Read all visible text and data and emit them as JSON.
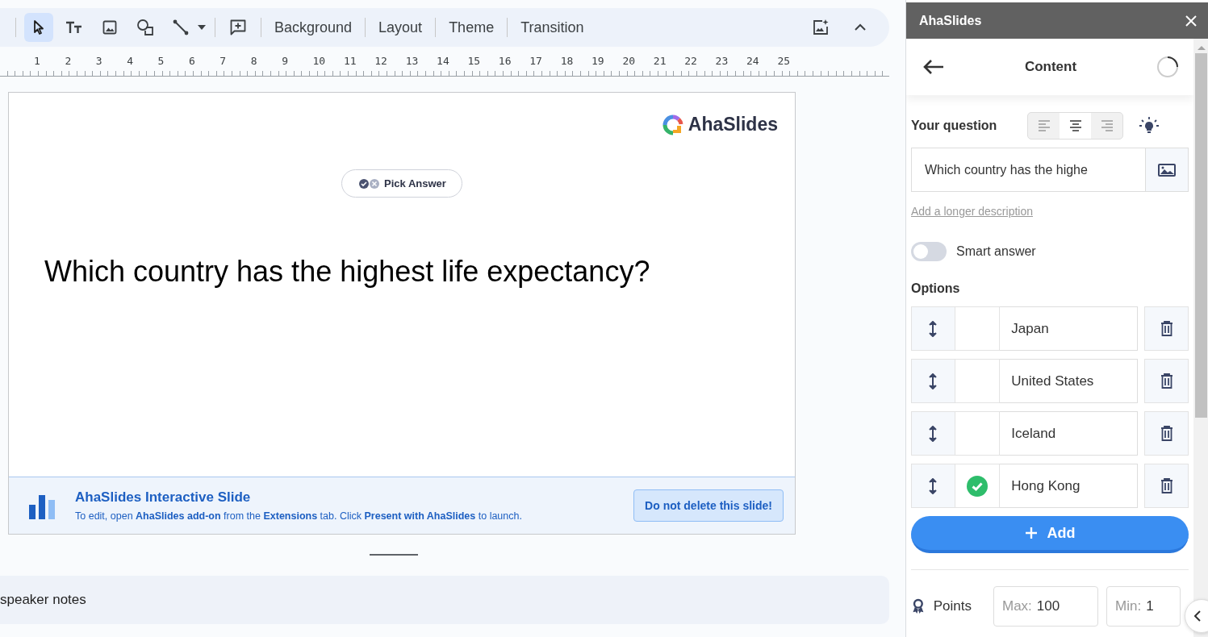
{
  "toolbar": {
    "tools": [
      {
        "kind": "pointer",
        "selected": true
      },
      {
        "kind": "text",
        "selected": false
      },
      {
        "kind": "image",
        "selected": false
      },
      {
        "kind": "shape",
        "selected": false
      },
      {
        "kind": "line",
        "selected": false
      },
      {
        "kind": "comment",
        "selected": false
      }
    ],
    "menu_buttons": [
      "Background",
      "Layout",
      "Theme",
      "Transition"
    ]
  },
  "ruler": [
    "1",
    "2",
    "3",
    "4",
    "5",
    "6",
    "7",
    "8",
    "9",
    "10",
    "11",
    "12",
    "13",
    "14",
    "15",
    "16",
    "17",
    "18",
    "19",
    "20",
    "21",
    "22",
    "23",
    "24",
    "25"
  ],
  "slide": {
    "logo_text": "AhaSlides",
    "badge": "Pick Answer",
    "question": "Which country has the highest life expectancy?",
    "banner": {
      "title": "AhaSlides Interactive Slide",
      "description": "To edit, open **AhaSlides add-on** from the **Extensions** tab. Click **Present with AhaSlides** to launch.",
      "button": "Do not delete this slide!"
    }
  },
  "speaker_notes": {
    "placeholder": "speaker notes"
  },
  "panel": {
    "title": "AhaSlides",
    "header": "Content",
    "question_label": "Your question",
    "alignment": [
      {
        "kind": "left",
        "selected": false
      },
      {
        "kind": "center",
        "selected": true
      },
      {
        "kind": "right",
        "selected": false
      }
    ],
    "question_value": "Which country has the highe",
    "description_link": "Add a longer description",
    "smart_answer": {
      "label": "Smart answer",
      "on": false
    },
    "options_label": "Options",
    "options": [
      {
        "text": "Japan",
        "correct": false
      },
      {
        "text": "United States",
        "correct": false
      },
      {
        "text": "Iceland",
        "correct": false
      },
      {
        "text": "Hong Kong",
        "correct": true
      }
    ],
    "add_button": "Add",
    "points": {
      "label": "Points",
      "max_label": "Max:",
      "max_value": "100",
      "min_label": "Min:",
      "min_value": "1"
    }
  }
}
